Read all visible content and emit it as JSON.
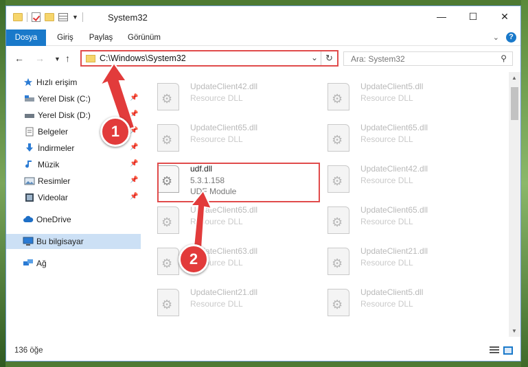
{
  "window": {
    "title": "System32",
    "controls": [
      "minimize-icon",
      "maximize-icon",
      "close-icon"
    ]
  },
  "ribbon": {
    "tabs": [
      "Dosya",
      "Giriş",
      "Paylaş",
      "Görünüm"
    ],
    "help_label": "?"
  },
  "address_bar": {
    "path": "C:\\Windows\\System32",
    "search_placeholder": "Ara: System32"
  },
  "nav": {
    "quick_access": "Hızlı erişim",
    "items": [
      {
        "label": "Yerel Disk (C:)",
        "icon": "drive-icon",
        "pinned": true
      },
      {
        "label": "Yerel Disk (D:)",
        "icon": "drive-icon",
        "pinned": true
      },
      {
        "label": "Belgeler",
        "icon": "documents-icon",
        "pinned": true
      },
      {
        "label": "İndirmeler",
        "icon": "download-icon",
        "pinned": true
      },
      {
        "label": "Müzik",
        "icon": "music-icon",
        "pinned": true
      },
      {
        "label": "Resimler",
        "icon": "pictures-icon",
        "pinned": true
      },
      {
        "label": "Videolar",
        "icon": "videos-icon",
        "pinned": true
      }
    ],
    "onedrive": "OneDrive",
    "this_pc": "Bu bilgisayar",
    "network": "Ağ"
  },
  "files": [
    {
      "name": "UpdateClient42.dll",
      "desc": "Resource DLL"
    },
    {
      "name": "UpdateClient5.dll",
      "desc": "Resource DLL"
    },
    {
      "name": "UpdateClient65.dll",
      "desc": "Resource DLL"
    },
    {
      "name": "UpdateClient65.dll",
      "desc": "Resource DLL"
    },
    {
      "name": "udf.dll",
      "version": "5.3.1.158",
      "desc": "UDF Module"
    },
    {
      "name": "UpdateClient42.dll",
      "desc": "Resource DLL"
    },
    {
      "name": "UpdateClient65.dll",
      "desc": "Resource DLL"
    },
    {
      "name": "UpdateClient65.dll",
      "desc": "Resource DLL"
    },
    {
      "name": "UpdateClient63.dll",
      "desc": "Resource DLL"
    },
    {
      "name": "UpdateClient21.dll",
      "desc": "Resource DLL"
    },
    {
      "name": "UpdateClient21.dll",
      "desc": "Resource DLL"
    },
    {
      "name": "UpdateClient5.dll",
      "desc": "Resource DLL"
    }
  ],
  "status": {
    "item_count": "136 öğe"
  },
  "markers": [
    "1",
    "2"
  ],
  "colors": {
    "accent": "#1979ca",
    "highlight": "#e04a4a",
    "selection": "#cce0f5"
  }
}
